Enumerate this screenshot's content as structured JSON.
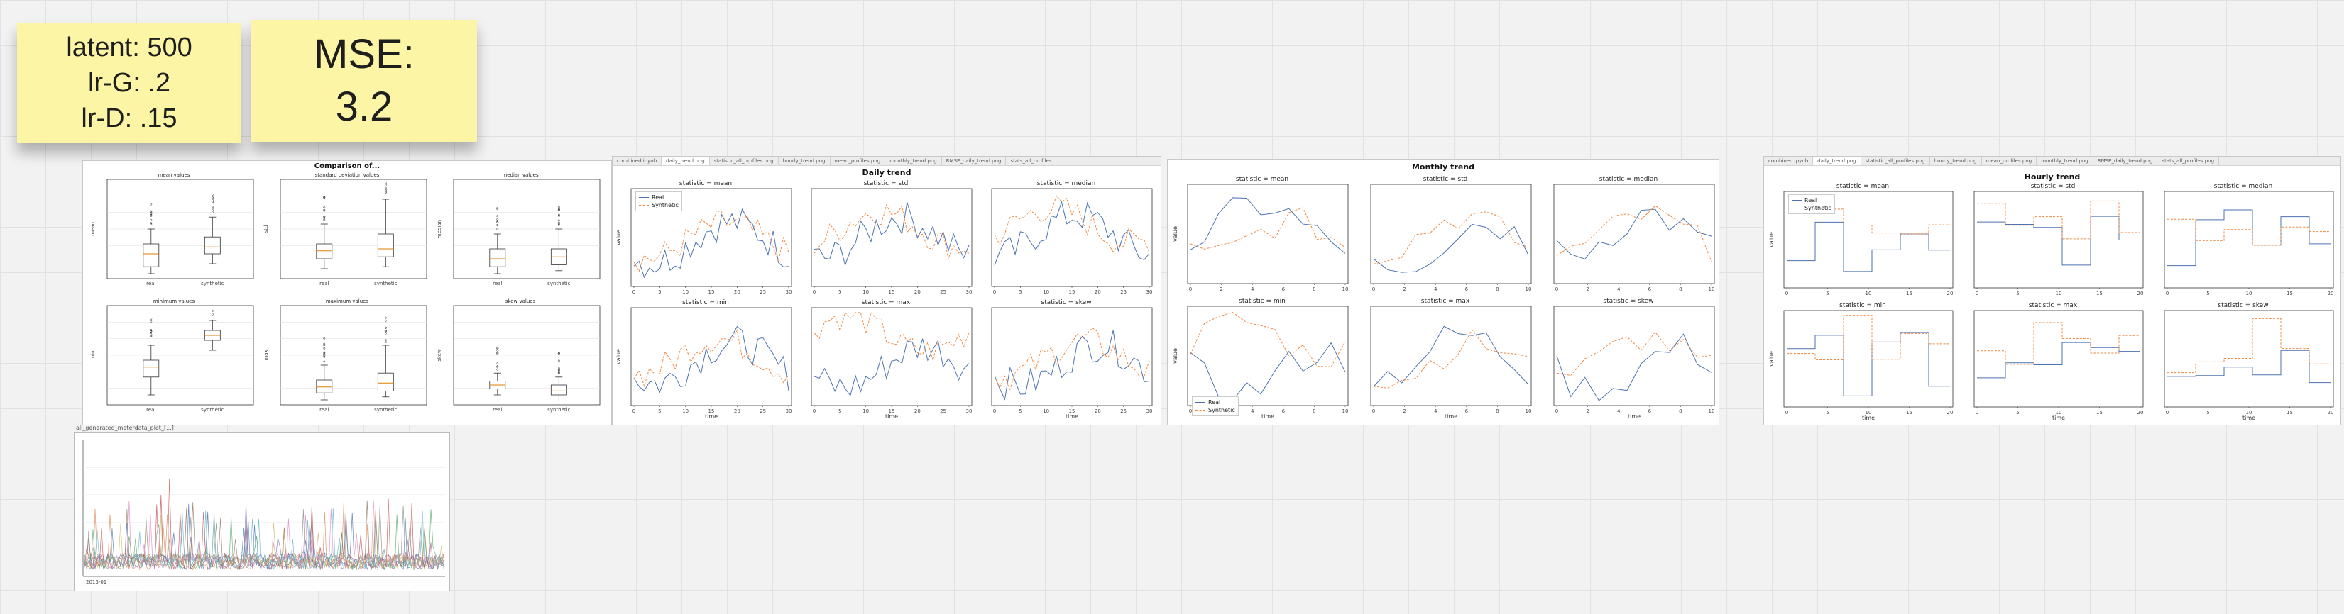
{
  "notes": {
    "note1": {
      "lines": [
        "latent: 500",
        "lr-G: .2",
        "lr-D: .15"
      ]
    },
    "note2": {
      "lines": [
        "MSE:",
        "3.2"
      ]
    }
  },
  "box_panel": {
    "title": "Comparison of...",
    "xticks": [
      "real",
      "synthetic"
    ],
    "subplots": [
      {
        "title": "mean values",
        "ylabel": "mean",
        "real": [
          0.05,
          0.12,
          0.25,
          0.35,
          0.5
        ],
        "synthetic": [
          0.15,
          0.25,
          0.32,
          0.42,
          0.62
        ]
      },
      {
        "title": "standard deviation values",
        "ylabel": "std",
        "real": [
          0.1,
          0.2,
          0.28,
          0.35,
          0.55
        ],
        "synthetic": [
          0.12,
          0.22,
          0.3,
          0.45,
          0.8
        ]
      },
      {
        "title": "median values",
        "ylabel": "median",
        "real": [
          0.05,
          0.12,
          0.2,
          0.3,
          0.45
        ],
        "synthetic": [
          0.08,
          0.14,
          0.22,
          0.3,
          0.5
        ]
      },
      {
        "title": "minimum values",
        "ylabel": "min",
        "real": [
          0.1,
          0.28,
          0.38,
          0.45,
          0.6
        ],
        "synthetic": [
          0.55,
          0.65,
          0.7,
          0.75,
          0.85
        ]
      },
      {
        "title": "maximum values",
        "ylabel": "max",
        "real": [
          0.05,
          0.12,
          0.18,
          0.25,
          0.4
        ],
        "synthetic": [
          0.08,
          0.14,
          0.22,
          0.32,
          0.6
        ]
      },
      {
        "title": "skew values",
        "ylabel": "skew",
        "real": [
          0.1,
          0.16,
          0.2,
          0.24,
          0.32
        ],
        "synthetic": [
          0.04,
          0.1,
          0.14,
          0.2,
          0.28
        ]
      }
    ]
  },
  "daily_panel": {
    "tabs": [
      "combined.ipynb",
      "daily_trend.png",
      "statistic_all_profiles.png",
      "hourly_trend.png",
      "mean_profiles.png",
      "monthly_trend.png",
      "RMSE_daily_trend.png",
      "stats_all_profiles"
    ],
    "title": "Daily trend",
    "xlabel": "time",
    "ylabel": "value",
    "xticks": [
      "0",
      "5",
      "10",
      "15",
      "20",
      "25",
      "30"
    ]
  },
  "monthly_panel": {
    "title": "Monthly trend",
    "xlabel": "time",
    "ylabel": "value",
    "xticks": [
      "0",
      "2",
      "4",
      "6",
      "8",
      "10"
    ]
  },
  "hourly_panel": {
    "tabs": [
      "combined.ipynb",
      "daily_trend.png",
      "statistic_all_profiles.png",
      "hourly_trend.png",
      "mean_profiles.png",
      "monthly_trend.png",
      "RMSE_daily_trend.png",
      "stats_all_profiles.png"
    ],
    "title": "Hourly trend",
    "xlabel": "time",
    "ylabel": "value",
    "xticks": [
      "0",
      "5",
      "10",
      "15",
      "20"
    ]
  },
  "stat_titles": [
    "statistic = mean",
    "statistic = std",
    "statistic = median",
    "statistic = min",
    "statistic = max",
    "statistic = skew"
  ],
  "legend": {
    "real": "Real",
    "synthetic": "Synthetic"
  },
  "bottom_panel": {
    "caption": "all_generated_meterdata_plot_[...]",
    "xlabel": "2013-01"
  },
  "colors": {
    "real": "#4c72b0",
    "synthetic": "#f0883e",
    "note": "#fdf5a6"
  }
}
